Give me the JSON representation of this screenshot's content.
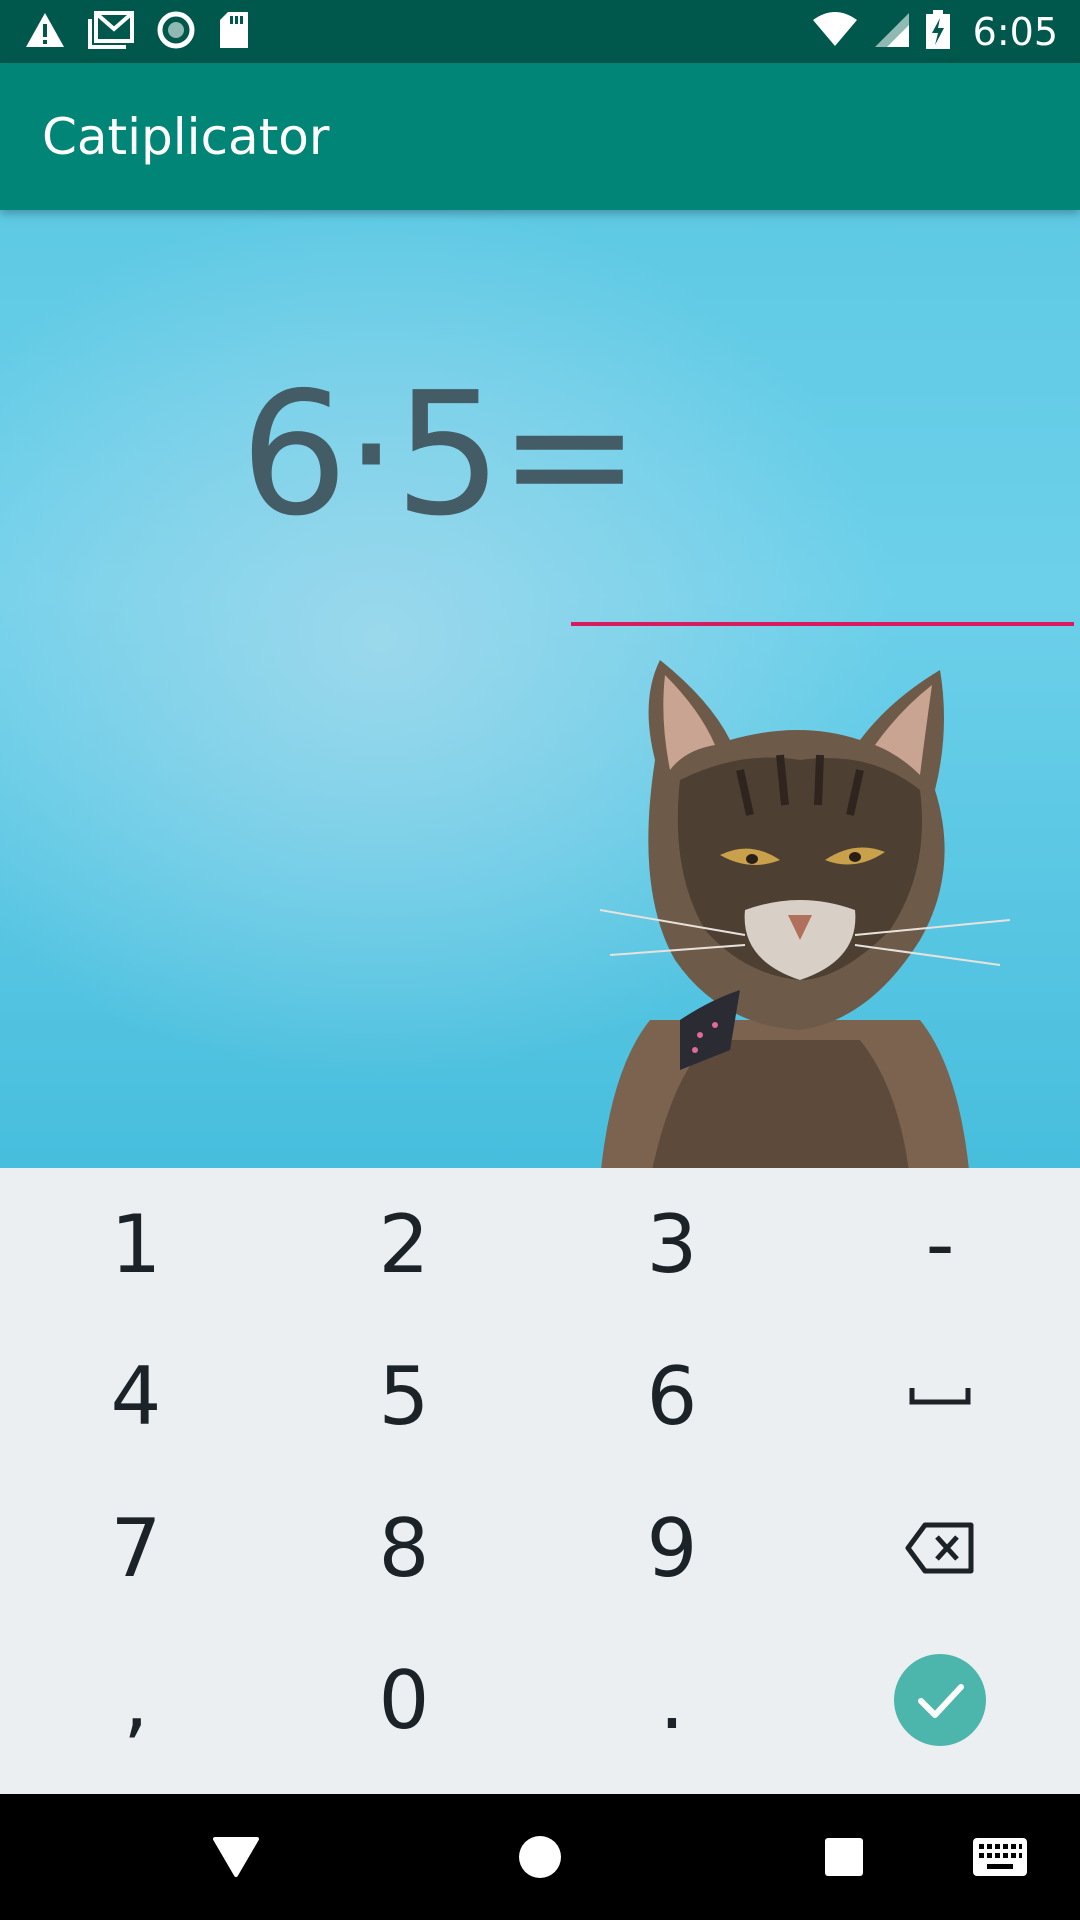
{
  "status_bar": {
    "time": "6:05",
    "left_icons": [
      "warning-icon",
      "gmail-icon",
      "sync-circle-icon",
      "sd-card-icon"
    ],
    "right_icons": [
      "wifi-icon",
      "cell-signal-icon",
      "battery-charging-icon"
    ]
  },
  "app_bar": {
    "title": "Catiplicator"
  },
  "question": {
    "equation": "6·5=",
    "answer_value": "",
    "underline_color": "#d81b60"
  },
  "keypad": {
    "rows": [
      [
        "1",
        "2",
        "3",
        "-"
      ],
      [
        "4",
        "5",
        "6",
        "space-icon"
      ],
      [
        "7",
        "8",
        "9",
        "backspace-icon"
      ],
      [
        ",",
        "0",
        ".",
        "done-icon"
      ]
    ],
    "done_color": "#4db6ac"
  },
  "nav_bar": {
    "icons": [
      "back-icon",
      "home-icon",
      "recents-icon",
      "keyboard-icon"
    ]
  },
  "colors": {
    "status_bar": "#00574b",
    "app_bar": "#008577",
    "keypad_bg": "#eceff1"
  }
}
